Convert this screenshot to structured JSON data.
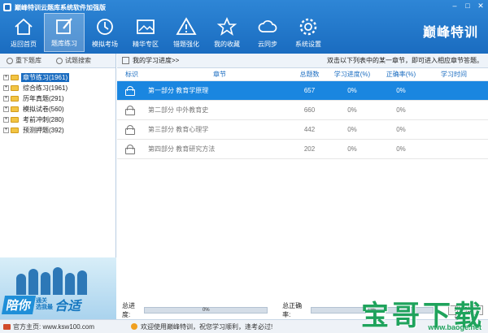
{
  "window": {
    "title": "巅峰特训云题库系统软件加强版",
    "controls": [
      "–",
      "□",
      "✕"
    ]
  },
  "toolbar": {
    "items": [
      {
        "label": "返回首页",
        "icon": "home-icon"
      },
      {
        "label": "题库练习",
        "icon": "edit-icon",
        "active": true
      },
      {
        "label": "模拟考场",
        "icon": "clock-icon"
      },
      {
        "label": "精华专区",
        "icon": "picture-icon"
      },
      {
        "label": "错题强化",
        "icon": "warning-icon"
      },
      {
        "label": "我的收藏",
        "icon": "star-icon"
      },
      {
        "label": "云同步",
        "icon": "cloud-sync-icon"
      },
      {
        "label": "系统设置",
        "icon": "gear-icon"
      }
    ],
    "brand": "巅峰特训"
  },
  "left": {
    "buttons": [
      "重下题库",
      "试题搜索"
    ],
    "tree": [
      {
        "label": "章节练习(1961)",
        "selected": true
      },
      {
        "label": "综合练习(1961)"
      },
      {
        "label": "历年真题(291)"
      },
      {
        "label": "模拟试卷(560)"
      },
      {
        "label": "考前冲刺(280)"
      },
      {
        "label": "预测押题(392)"
      }
    ],
    "banner": {
      "part1": "陪你",
      "mid1": "通关",
      "mid2": "选我最",
      "part2": "合适"
    }
  },
  "right": {
    "progress_link": "我的学习进度>>",
    "hint": "双击以下列表中的某一章节，即可进入相应章节答题。",
    "columns": [
      "标识",
      "章节",
      "总题数",
      "学习进度(%)",
      "正确率(%)",
      "学习时间"
    ],
    "rows": [
      {
        "chapter": "第一部分  教育学原理",
        "total": "657",
        "progress": "0%",
        "accuracy": "0%",
        "time": "",
        "selected": true
      },
      {
        "chapter": "第二部分  中外教育史",
        "total": "660",
        "progress": "0%",
        "accuracy": "0%",
        "time": ""
      },
      {
        "chapter": "第三部分  教育心理学",
        "total": "442",
        "progress": "0%",
        "accuracy": "0%",
        "time": ""
      },
      {
        "chapter": "第四部分  教育研究方法",
        "total": "202",
        "progress": "0%",
        "accuracy": "0%",
        "time": ""
      }
    ],
    "summary": {
      "progress_label": "总进度:",
      "progress_value": "0%",
      "accuracy_label": "总正确率:",
      "accuracy_value": "0%",
      "button": "学习统计"
    }
  },
  "status": {
    "home": "官方主页: www.ksw100.com",
    "message": "欢迎使用巅峰特训，祝您学习顺利，逢考必过!"
  },
  "watermark": {
    "text": "宝哥下载",
    "url": "www.baoge.net"
  }
}
